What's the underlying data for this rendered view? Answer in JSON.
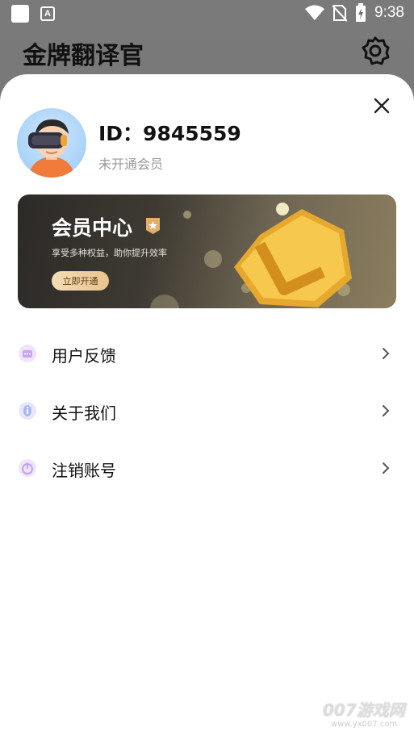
{
  "status_bar": {
    "time": "9:38",
    "icons": [
      "notification-square-icon",
      "text-a-icon",
      "wifi-icon",
      "no-sim-icon",
      "battery-charging-icon"
    ]
  },
  "background_app": {
    "title": "金牌翻译官",
    "settings_icon": "gear-icon"
  },
  "profile": {
    "id_text": "ID：9845559",
    "member_status": "未开通会员"
  },
  "banner": {
    "title": "会员中心",
    "subtitle": "享受多种权益，助你提升效率",
    "button_label": "立即开通"
  },
  "menu": {
    "items": [
      {
        "label": "用户反馈",
        "icon": "feedback-chat-icon"
      },
      {
        "label": "关于我们",
        "icon": "info-icon"
      },
      {
        "label": "注销账号",
        "icon": "power-icon"
      }
    ]
  },
  "watermark": {
    "brand": "007游戏网",
    "url": "www.yx007.com"
  },
  "colors": {
    "sheet_bg": "#ffffff",
    "banner_dark": "#2c2a27",
    "gold": "#f2c24a",
    "button_gold": "#e8c38e"
  }
}
